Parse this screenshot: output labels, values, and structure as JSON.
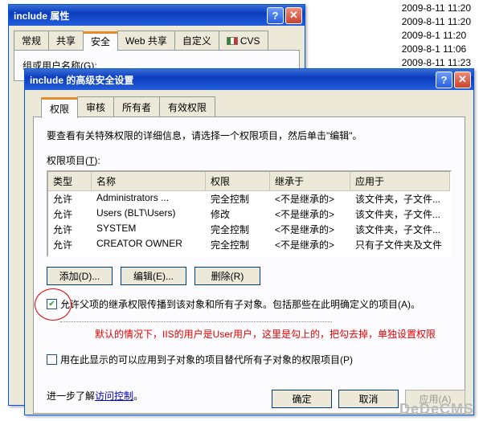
{
  "bg_dates": [
    "2009-8-11 11:20",
    "2009-8-11 11:20",
    "2009-8-1 11:20",
    "2009-8-1 11:06",
    "2009-8-11 11:23"
  ],
  "win1": {
    "title": "include 属性",
    "tabs": [
      "常规",
      "共享",
      "安全",
      "Web 共享",
      "自定义",
      "CVS"
    ],
    "active_tab": 2,
    "line": "组或用户名称(G):"
  },
  "win2": {
    "title": "include 的高级安全设置",
    "tabs": [
      "权限",
      "审核",
      "所有者",
      "有效权限"
    ],
    "active_tab": 0,
    "instruction": "要查看有关特殊权限的详细信息，请选择一个权限项目，然后单击\"编辑\"。",
    "list_label_pre": "权限项目(",
    "list_label_key": "T",
    "list_label_post": "):",
    "cols": [
      "类型",
      "名称",
      "权限",
      "继承于",
      "应用于"
    ],
    "rows": [
      [
        "允许",
        "Administrators ...",
        "完全控制",
        "<不是继承的>",
        "该文件夹，子文件..."
      ],
      [
        "允许",
        "Users (BLT\\Users)",
        "修改",
        "<不是继承的>",
        "该文件夹，子文件..."
      ],
      [
        "允许",
        "SYSTEM",
        "完全控制",
        "<不是继承的>",
        "该文件夹，子文件..."
      ],
      [
        "允许",
        "CREATOR OWNER",
        "完全控制",
        "<不是继承的>",
        "只有子文件夹及文件"
      ]
    ],
    "buttons": {
      "add": "添加(D)...",
      "edit": "编辑(E)...",
      "remove": "删除(R)"
    },
    "chk1": {
      "checked": true,
      "label": "允许父项的继承权限传播到该对象和所有子对象。包括那些在此明确定义的项目(A)。"
    },
    "red_note": "默认的情况下，IIS的用户是User用户，这里是勾上的，把勾去掉，单独设置权限",
    "chk2": {
      "checked": false,
      "label": "用在此显示的可以应用到子对象的项目替代所有子对象的权限项目(P)"
    },
    "learn_pre": "进一步了解",
    "learn_link": "访问控制",
    "learn_post": "。",
    "footer": {
      "ok": "确定",
      "cancel": "取消",
      "apply": "应用(A)"
    }
  },
  "watermark": "DeDeCMS"
}
